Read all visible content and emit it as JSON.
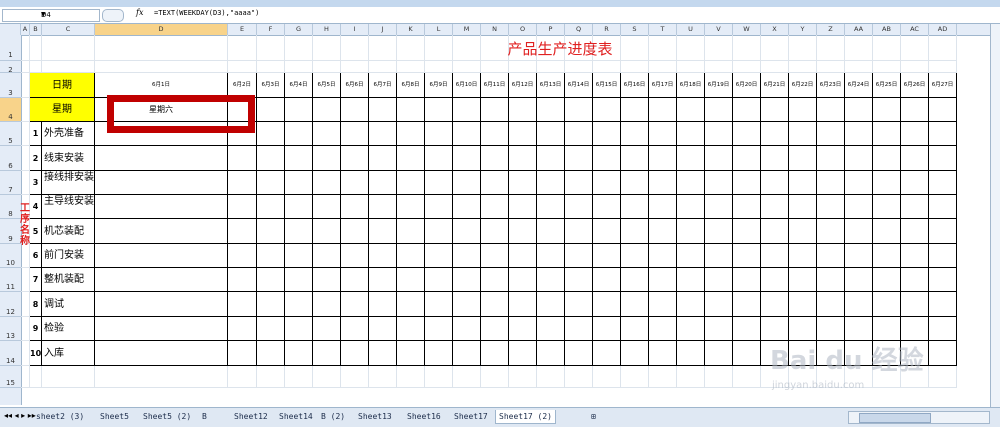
{
  "formula_bar": {
    "name_box": "D4",
    "fx_label": "fx",
    "formula": "=TEXT(WEEKDAY(D3),\"aaaa\")"
  },
  "columns": [
    "A",
    "B",
    "C",
    "D",
    "E",
    "F",
    "G",
    "H",
    "I",
    "J",
    "K",
    "L",
    "M",
    "N",
    "O",
    "P",
    "Q",
    "R",
    "S",
    "T",
    "U",
    "V",
    "W",
    "X",
    "Y",
    "Z",
    "AA",
    "AB",
    "AC",
    "AD"
  ],
  "rows": [
    "1",
    "2",
    "3",
    "4",
    "5",
    "6",
    "7",
    "8",
    "9",
    "10",
    "11",
    "12",
    "13",
    "14",
    "15"
  ],
  "sheet": {
    "title": "产品生产进度表",
    "date_label": "日期",
    "weekday_label": "星期",
    "d3_value": "6月1日",
    "d4_value": "星期六",
    "dates": [
      "6月2日",
      "6月3日",
      "6月4日",
      "6月5日",
      "6月6日",
      "6月7日",
      "6月8日",
      "6月9日",
      "6月10日",
      "6月11日",
      "6月12日",
      "6月13日",
      "6月14日",
      "6月15日",
      "6月16日",
      "6月17日",
      "6月18日",
      "6月19日",
      "6月20日",
      "6月21日",
      "6月22日",
      "6月23日",
      "6月24日",
      "6月25日",
      "6月26日",
      "6月27日",
      "6月2"
    ],
    "process_group_label": [
      "工",
      "序",
      "名",
      "称"
    ],
    "processes": [
      {
        "num": "1",
        "name": "外壳准备"
      },
      {
        "num": "2",
        "name": "线束安装"
      },
      {
        "num": "3",
        "name": "接线排安装"
      },
      {
        "num": "4",
        "name": "主导线安装"
      },
      {
        "num": "5",
        "name": "机芯装配"
      },
      {
        "num": "6",
        "name": "前门安装"
      },
      {
        "num": "7",
        "name": "整机装配"
      },
      {
        "num": "8",
        "name": "调试"
      },
      {
        "num": "9",
        "name": "检验"
      },
      {
        "num": "10",
        "name": "入库"
      }
    ]
  },
  "tabs": [
    "sheet2 (3)",
    "Sheet5",
    "Sheet5 (2)",
    "B",
    "Sheet12",
    "Sheet14",
    "B (2)",
    "Sheet13",
    "Sheet16",
    "Sheet17",
    "Sheet17 (2)"
  ],
  "active_tab": "Sheet17 (2)",
  "watermark": {
    "logo": "Bai du 经验",
    "url": "jingyan.baidu.com"
  }
}
